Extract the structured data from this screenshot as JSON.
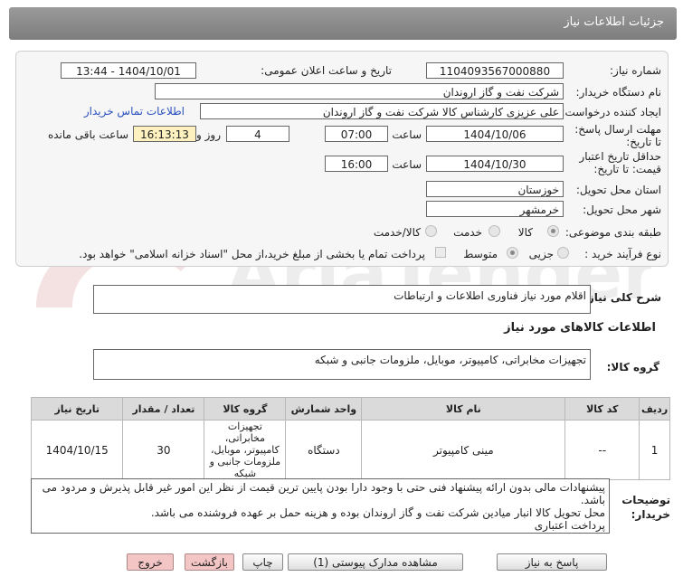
{
  "header": {
    "title": "جزئیات اطلاعات نیاز"
  },
  "fields": {
    "need_number_label": "شماره نیاز:",
    "need_number": "1104093567000880",
    "announce_label": "تاریخ و ساعت اعلان عمومی:",
    "announce_value": "1404/10/01 - 13:44",
    "buyer_org_label": "نام دستگاه خریدار:",
    "buyer_org": "شرکت نفت و گاز اروندان",
    "requester_label": "ایجاد کننده درخواست:",
    "requester": "علی عزیزی کارشناس کالا شرکت نفت و گاز اروندان",
    "contact_link": "اطلاعات تماس خریدار",
    "deadline_label": "مهلت ارسال پاسخ: تا تاریخ:",
    "deadline_date": "1404/10/06",
    "hour_label": "ساعت",
    "deadline_hour": "07:00",
    "days_value": "4",
    "days_label": "روز و",
    "remaining_time": "16:13:13",
    "remaining_label": "ساعت باقی مانده",
    "validity_label": "حداقل تاریخ اعتبار قیمت: تا تاریخ:",
    "validity_date": "1404/10/30",
    "validity_hour": "16:00",
    "province_label": "استان محل تحویل:",
    "province": "خوزستان",
    "city_label": "شهر محل تحویل:",
    "city": "خرمشهر",
    "category_label": "طبقه بندی موضوعی:",
    "category_options": [
      "کالا",
      "خدمت",
      "کالا/خدمت"
    ],
    "process_label": "نوع فرآیند خرید :",
    "process_options": [
      "جزیی",
      "متوسط"
    ],
    "payment_note": "پرداخت تمام یا بخشی از مبلغ خرید،از محل \"اسناد خزانه اسلامی\" خواهد بود."
  },
  "summary": {
    "label": "شرح کلی نیاز:",
    "value": "اقلام مورد نیاز فناوری اطلاعات و ارتباطات"
  },
  "goods_info_title": "اطلاعات کالاهای مورد نیاز",
  "goods_group": {
    "label": "گروه کالا:",
    "value": "تجهیزات مخابراتی، کامپیوتر، موبایل، ملزومات جانبی و شبکه"
  },
  "table": {
    "headers": [
      "ردیف",
      "کد کالا",
      "نام کالا",
      "واحد شمارش",
      "گروه کالا",
      "تعداد / مقدار",
      "تاریخ نیاز"
    ],
    "rows": [
      [
        "1",
        "--",
        "مینی کامپیوتر",
        "دستگاه",
        "تجهیزات مخابراتی، کامپیوتر، موبایل، ملزومات جانبی و شبکه",
        "30",
        "1404/10/15"
      ]
    ]
  },
  "buyer_notes": {
    "label": "توضیحات خریدار:",
    "lines": [
      "پیشنهادات مالی بدون ارائه پیشنهاد فنی حتی با وجود دارا بودن پایین ترین قیمت از نظر این امور غیر قابل پذیرش و مردود می باشد.",
      "محل تحویل کالا انبار میادین شرکت نفت و گاز اروندان بوده و هزینه حمل بر عهده فروشنده می باشد.",
      "پرداخت اعتباری"
    ]
  },
  "buttons": {
    "reply": "پاسخ به نیاز",
    "attachments": "مشاهده مدارک پیوستی (1)",
    "print": "چاپ",
    "back": "بازگشت",
    "exit": "خروج"
  },
  "watermark": {
    "text": "AriaTender.neT"
  },
  "colors": {
    "header": "#8c8c8c",
    "link": "#2a52be",
    "timer_bg": "#fdf2bf",
    "exit_bg": "#f4c5c5"
  }
}
